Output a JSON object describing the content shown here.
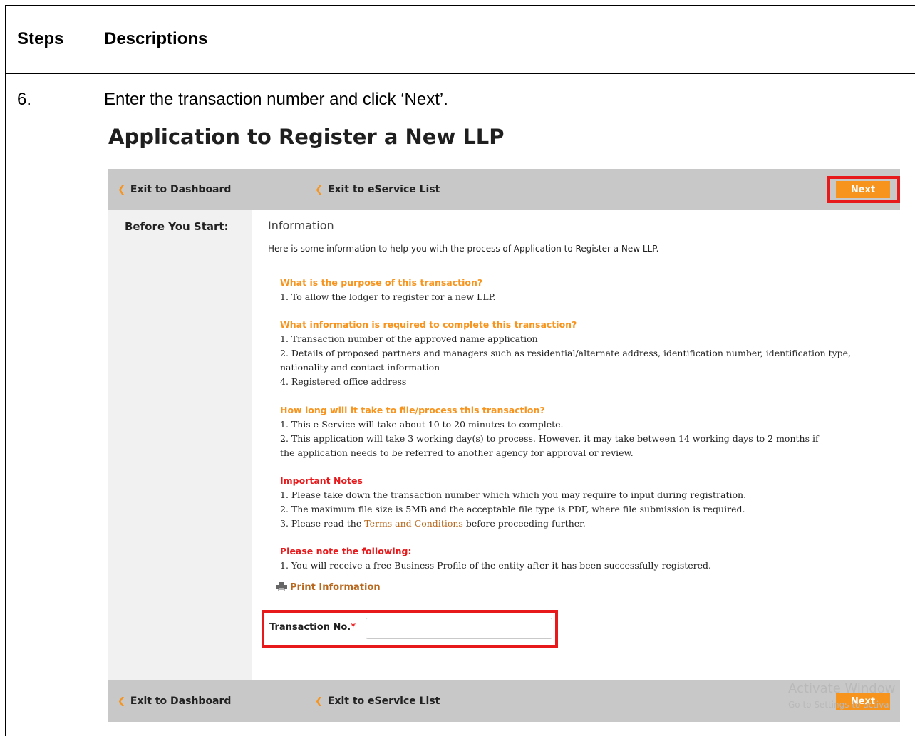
{
  "table": {
    "header_steps": "Steps",
    "header_descriptions": "Descriptions",
    "step_number": "6.",
    "step_description": "Enter the transaction number and click ‘Next’."
  },
  "screenshot": {
    "page_title": "Application to Register a New LLP",
    "nav": {
      "exit_dashboard": "Exit to Dashboard",
      "exit_eservice": "Exit to eService List",
      "next": "Next"
    },
    "sidebar_label": "Before You Start:",
    "info_heading": "Information",
    "info_intro": "Here is some information to help you with the process of Application to Register a New LLP.",
    "purpose": {
      "heading": "What is the purpose of this transaction?",
      "lines": [
        "1. To allow the lodger to register for a new LLP."
      ]
    },
    "required_info": {
      "heading": "What information is required to complete this transaction?",
      "lines": [
        "1. Transaction number of the approved name application",
        "2. Details of proposed partners and managers such as residential/alternate address, identification number, identification type,",
        "nationality and contact information",
        "4. Registered office address"
      ]
    },
    "duration": {
      "heading": "How long will it take to file/process this transaction?",
      "lines": [
        "1. This e-Service will take about 10 to 20 minutes to complete.",
        "2. This application will take 3 working day(s) to process. However, it may take between 14 working days to 2 months if",
        "the application needs to be referred to another agency for approval or review."
      ]
    },
    "important_notes": {
      "heading": "Important Notes",
      "line1": "1. Please take down the transaction number which which you may require to input during registration.",
      "line2": "2. The maximum file size is 5MB and the acceptable file type is PDF, where file submission is required.",
      "line3_prefix": "3. Please read the",
      "line3_link": "Terms and Conditions",
      "line3_suffix": "before proceeding further."
    },
    "please_note": {
      "heading": "Please note the following:",
      "lines": [
        "1. You will receive a free Business Profile of the entity after it has been successfully registered."
      ]
    },
    "print_label": "Print Information",
    "transaction": {
      "label": "Transaction No.",
      "required_mark": "*",
      "value": "",
      "placeholder": ""
    },
    "watermark": {
      "line1": "Activate Window",
      "line2": "Go to Settings to activa"
    },
    "colors": {
      "accent_orange": "#f7941d",
      "highlight_red": "#e8191b",
      "bar_gray": "#c8c8c8"
    }
  }
}
